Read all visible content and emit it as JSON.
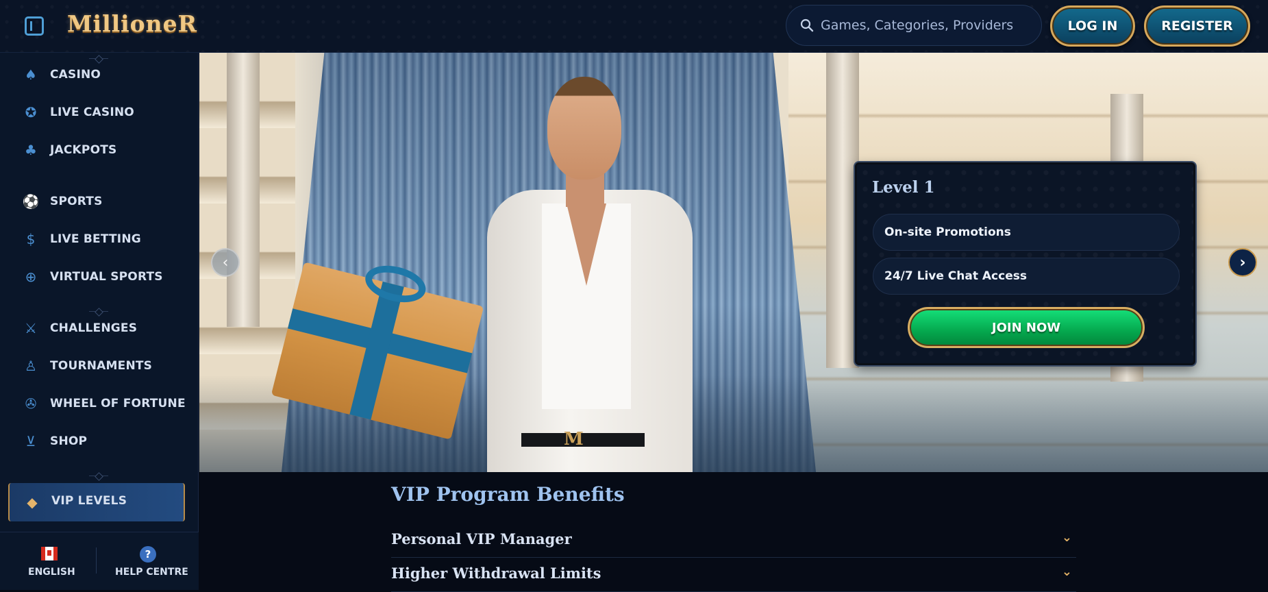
{
  "header": {
    "logo": "MillioneR",
    "search_placeholder": "Games, Categories, Providers",
    "login_label": "LOG IN",
    "register_label": "REGISTER"
  },
  "sidebar": {
    "items": [
      {
        "label": "CASINO",
        "icon": "spade-icon"
      },
      {
        "label": "LIVE CASINO",
        "icon": "chip-icon"
      },
      {
        "label": "JACKPOTS",
        "icon": "clover-icon"
      },
      {
        "label": "SPORTS",
        "icon": "soccer-ball-icon"
      },
      {
        "label": "LIVE BETTING",
        "icon": "coin-icon"
      },
      {
        "label": "VIRTUAL SPORTS",
        "icon": "target-icon"
      },
      {
        "label": "CHALLENGES",
        "icon": "swords-icon"
      },
      {
        "label": "TOURNAMENTS",
        "icon": "medal-icon"
      },
      {
        "label": "WHEEL OF FORTUNE",
        "icon": "wheel-icon"
      },
      {
        "label": "SHOP",
        "icon": "basket-icon"
      },
      {
        "label": "VIP LEVELS",
        "icon": "diamond-icon"
      }
    ],
    "footer": {
      "language": "ENGLISH",
      "help": "HELP CENTRE"
    }
  },
  "level_card": {
    "title": "Level 1",
    "perks": [
      "On-site Promotions",
      "24/7 Live Chat Access"
    ],
    "join_label": "JOIN NOW"
  },
  "vip": {
    "title": "VIP Program Benefits",
    "benefits": [
      "Personal VIP Manager",
      "Higher Withdrawal Limits"
    ]
  },
  "colors": {
    "accent_gold": "#d7a85b",
    "brand_blue": "#4b8fd1",
    "join_green": "#05a84e"
  }
}
